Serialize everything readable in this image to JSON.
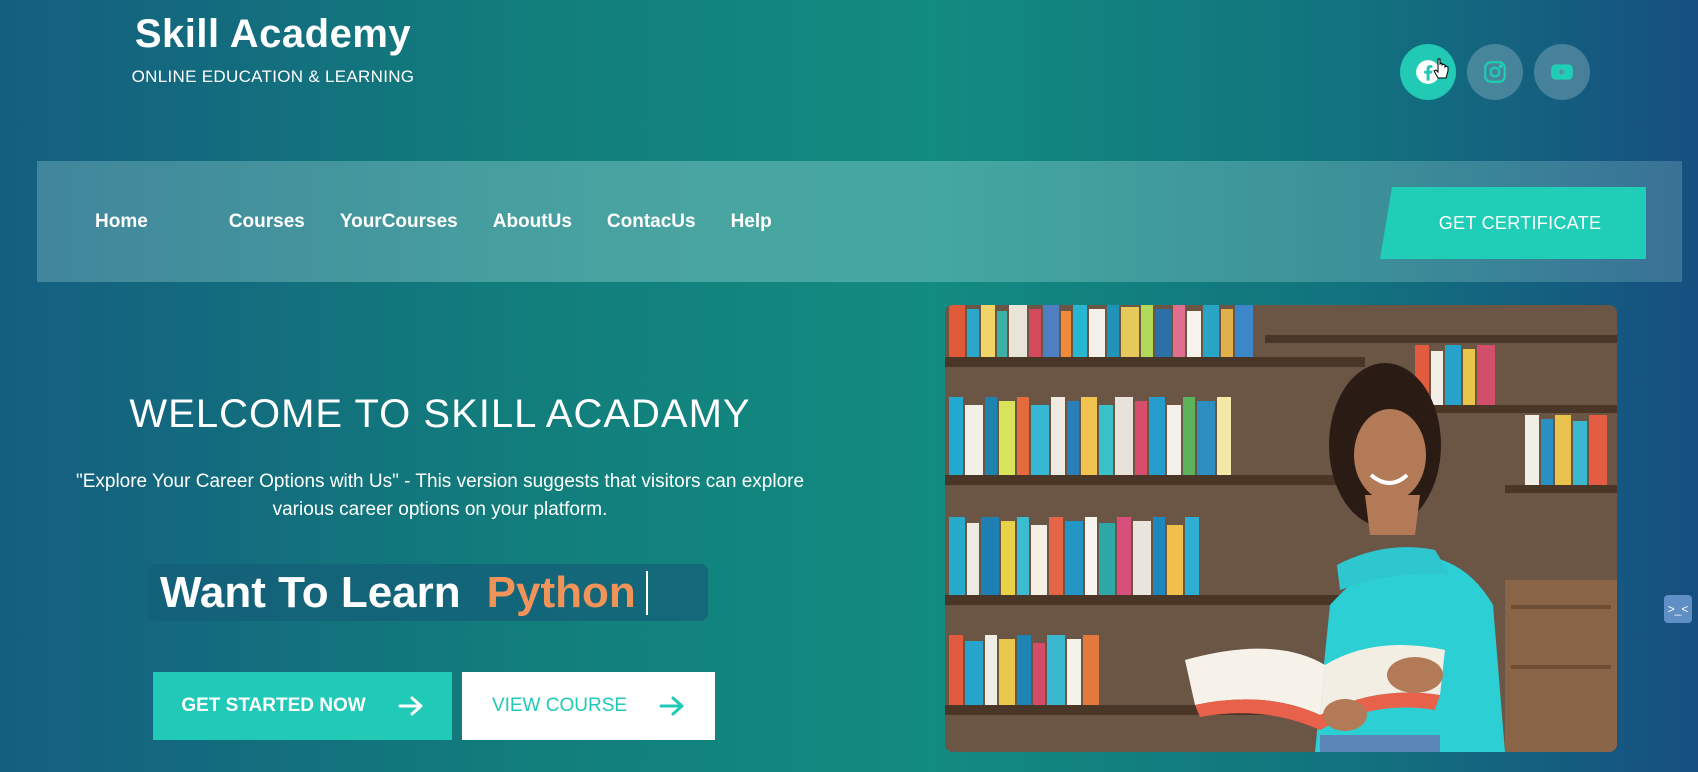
{
  "brand": {
    "title": "Skill Academy",
    "subtitle": "ONLINE EDUCATION & LEARNING"
  },
  "socials": [
    {
      "icon": "facebook-icon",
      "active": true
    },
    {
      "icon": "instagram-icon",
      "active": false
    },
    {
      "icon": "youtube-icon",
      "active": false
    }
  ],
  "nav": {
    "items": [
      "Home",
      "Courses",
      "YourCourses",
      "AboutUs",
      "ContacUs",
      "Help"
    ],
    "cta": "GET CERTIFICATE"
  },
  "hero": {
    "title": "WELCOME TO SKILL ACADAMY",
    "description_line1": "\"Explore Your Career Options with Us\" - This version suggests that visitors can explore",
    "description_line2": "various career options on your platform.",
    "learn_prefix": "Want To Learn",
    "learn_subject": "Python",
    "primary_button": "GET STARTED NOW",
    "secondary_button": "VIEW COURSE"
  },
  "colors": {
    "accent": "#21c9b7",
    "highlight": "#f2945a"
  }
}
